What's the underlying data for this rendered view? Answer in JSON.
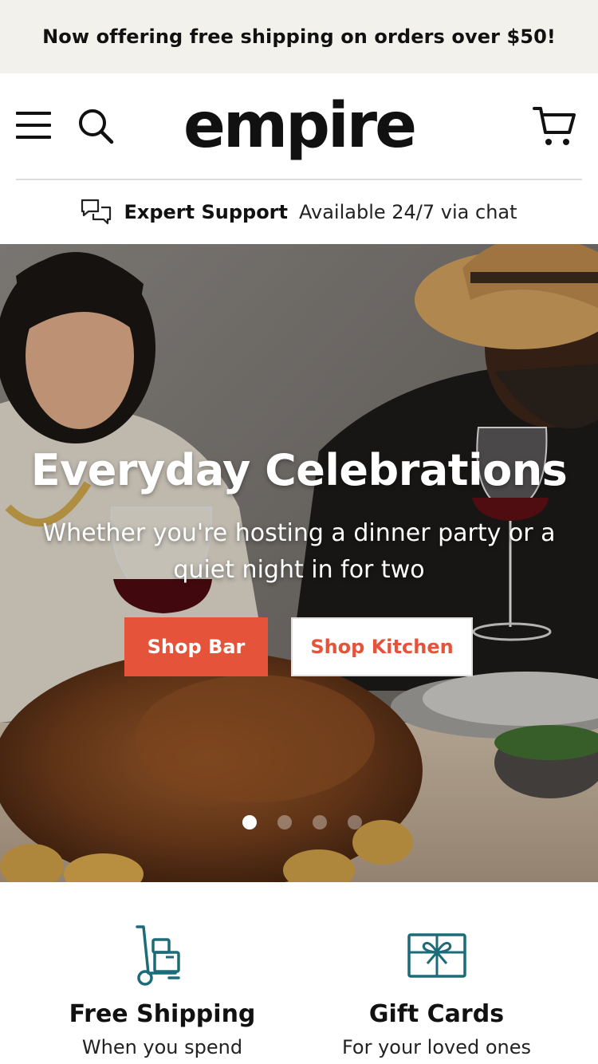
{
  "announcement": {
    "text": "Now offering free shipping on orders over $50!"
  },
  "header": {
    "logo": "empire",
    "menu_icon": "hamburger-menu-icon",
    "search_icon": "search-icon",
    "cart_icon": "shopping-cart-icon"
  },
  "support": {
    "icon": "chat-bubbles-icon",
    "title": "Expert Support",
    "text": "Available 24/7 via chat"
  },
  "hero": {
    "title": "Everyday Celebrations",
    "subtitle": "Whether you're hosting a dinner party or a quiet night in for two",
    "primary_button": "Shop Bar",
    "secondary_button": "Shop Kitchen",
    "slides_total": 4,
    "active_slide": 1
  },
  "features": [
    {
      "icon": "hand-truck-delivery-icon",
      "title": "Free Shipping",
      "subtitle": "When you spend"
    },
    {
      "icon": "gift-card-icon",
      "title": "Gift Cards",
      "subtitle": "For your loved ones"
    }
  ],
  "colors": {
    "accent": "#e5533a",
    "teal": "#1b6b78",
    "announcement_bg": "#f3f1ec"
  }
}
